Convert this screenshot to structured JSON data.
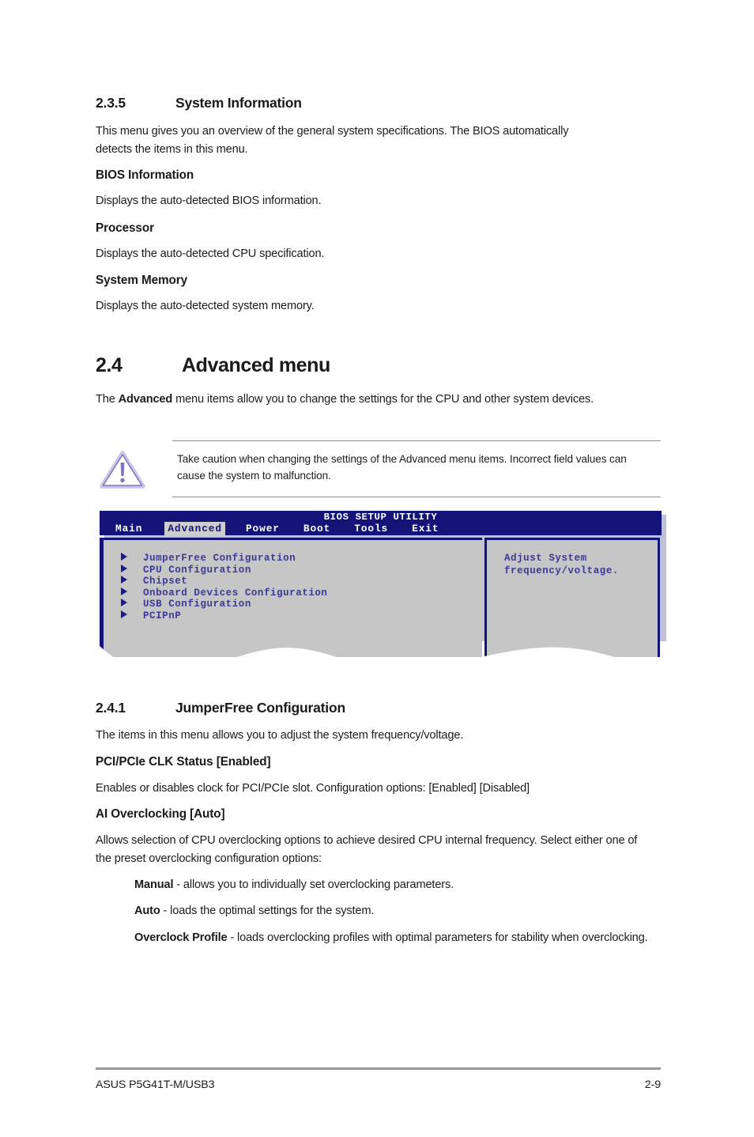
{
  "sections": {
    "system_information": {
      "number": "2.3.5",
      "title": "System Information",
      "intro": "This menu gives you an overview of the general system specifications. The BIOS automatically detects the items in this menu.",
      "items": [
        {
          "heading": "BIOS Information",
          "body": "Displays the auto-detected BIOS information."
        },
        {
          "heading": "Processor",
          "body": "Displays the auto-detected CPU specification."
        },
        {
          "heading": "System Memory",
          "body": "Displays the auto-detected system memory."
        }
      ]
    },
    "advanced_menu": {
      "number": "2.4",
      "title": "Advanced menu",
      "intro_part1": "The ",
      "intro_bold": "Advanced",
      "intro_part2": " menu items allow you to change the settings for the CPU and other system devices.",
      "note": {
        "icon": "caution-triangle-icon",
        "text": "Take caution when changing the settings of the Advanced menu items. Incorrect field values can cause the system to malfunction."
      }
    },
    "jumperfree": {
      "number": "2.4.1",
      "title": "JumperFree Configuration",
      "intro": "The items in this menu allows you to adjust the system frequency/voltage.",
      "pci_clk": {
        "heading": "PCI/PCIe CLK Status [Enabled]",
        "body": "Enables or disables clock for PCI/PCIe slot. Configuration options: [Enabled] [Disabled]"
      },
      "ai_overclocking": {
        "heading": "AI Overclocking [Auto]",
        "body": "Allows selection of CPU overclocking options to achieve desired CPU internal frequency. Select either one of the preset overclocking configuration options:",
        "options": [
          {
            "name": "Manual",
            "desc": " - allows you to individually set overclocking parameters."
          },
          {
            "name": "Auto",
            "desc": " - loads the optimal settings for the system."
          },
          {
            "name": "Overclock Profile",
            "desc": " - loads overclocking profiles with optimal parameters for stability when overclocking."
          }
        ]
      }
    }
  },
  "bios_screenshot": {
    "title": "BIOS SETUP UTILITY",
    "tabs": [
      {
        "label": "Main",
        "active": false
      },
      {
        "label": "Advanced",
        "active": true
      },
      {
        "label": "Power",
        "active": false
      },
      {
        "label": "Boot",
        "active": false
      },
      {
        "label": "Tools",
        "active": false
      },
      {
        "label": "Exit",
        "active": false
      }
    ],
    "menu_items": [
      "JumperFree Configuration",
      "CPU Configuration",
      "Chipset",
      "Onboard Devices Configuration",
      "USB Configuration",
      "PCIPnP"
    ],
    "help_text": "Adjust System\nfrequency/voltage.",
    "colors": {
      "header_blue": "#141478",
      "panel_gray": "#c6c6c6",
      "text_blue": "#3a3a94",
      "active_tab_bg": "#cdcdcd"
    }
  },
  "footer": {
    "model": "ASUS P5G41T-M/USB3",
    "page": "2-9"
  }
}
